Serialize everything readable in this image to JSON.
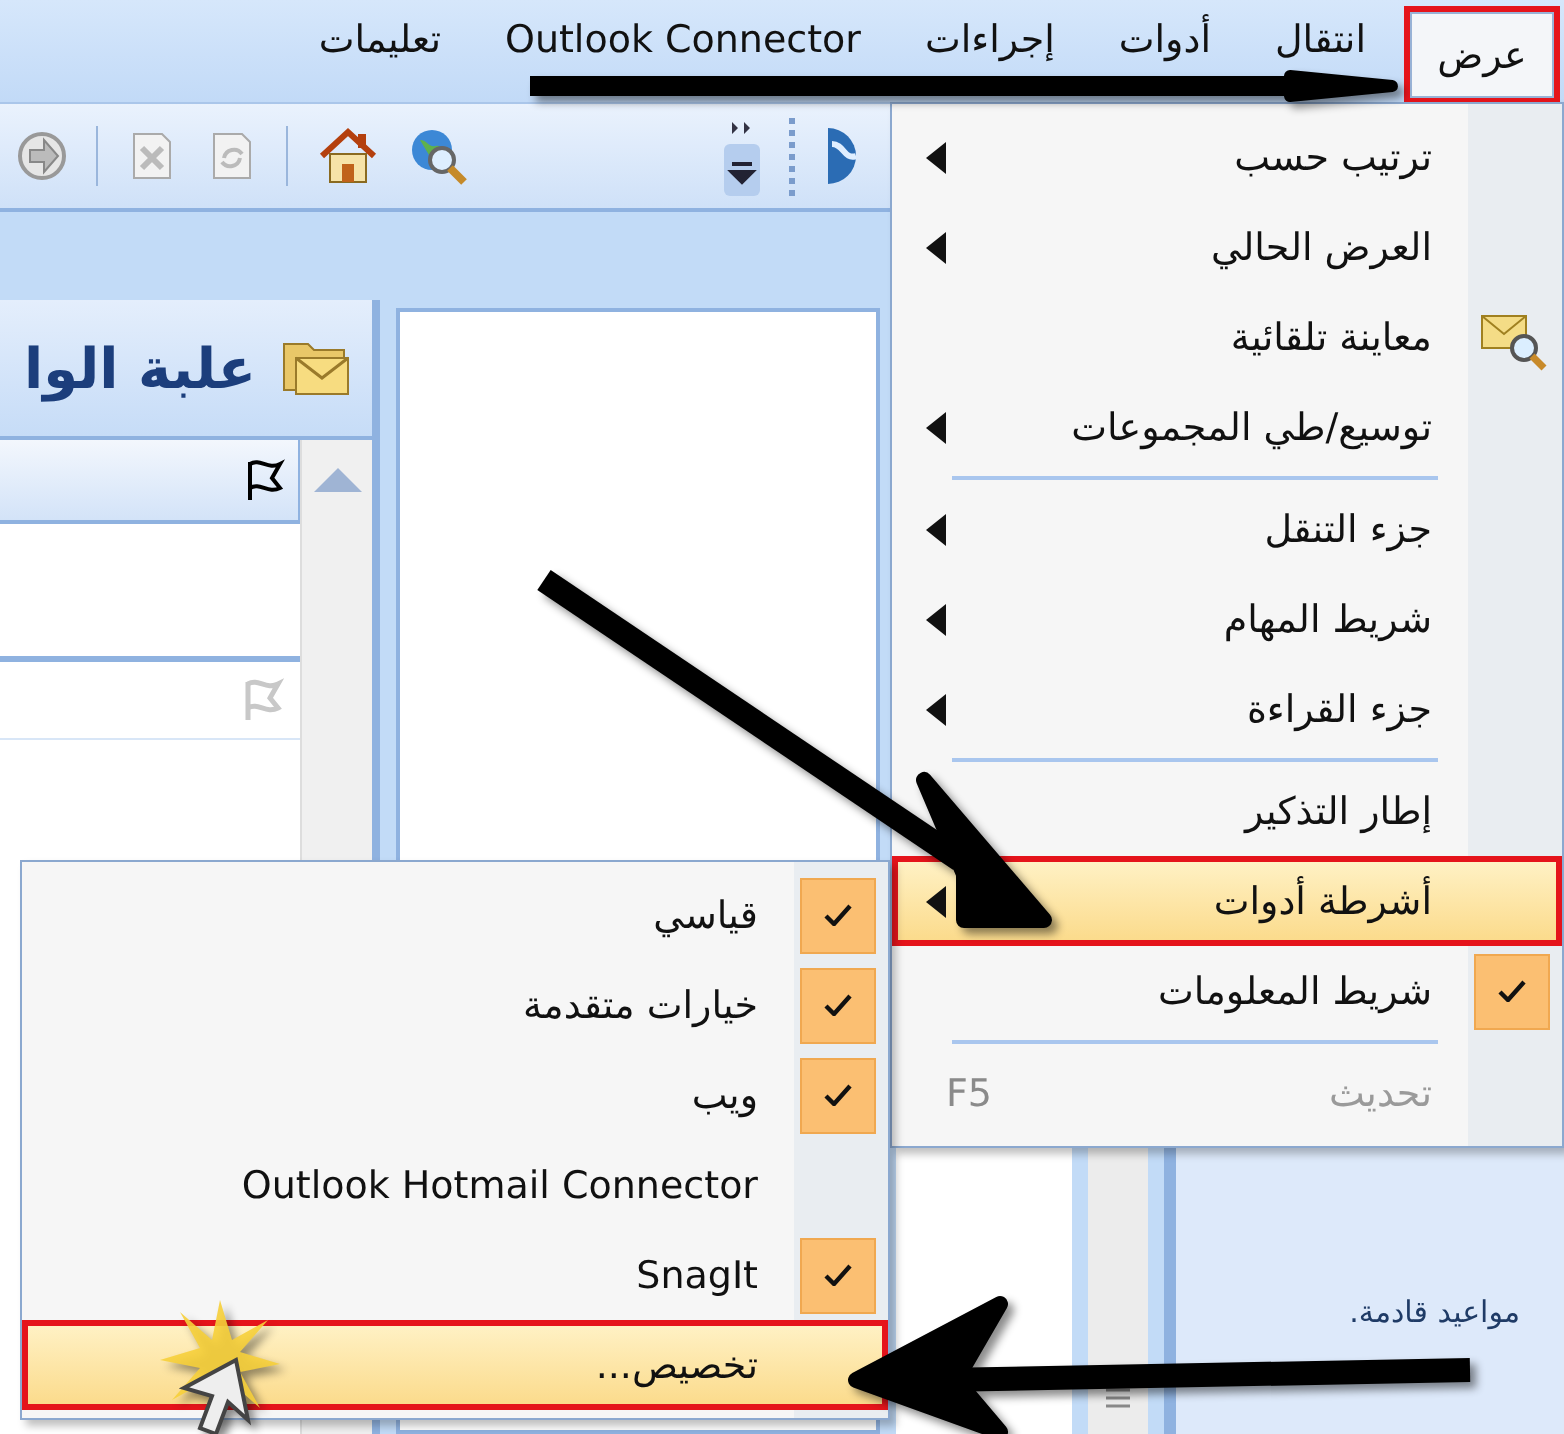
{
  "menu_bar": [
    {
      "label": "عرض",
      "selected": true
    },
    {
      "label": "انتقال",
      "selected": false
    },
    {
      "label": "أدوات",
      "selected": false
    },
    {
      "label": "إجراءات",
      "selected": false
    },
    {
      "label": "Outlook Connector",
      "selected": false
    },
    {
      "label": "تعليمات",
      "selected": false
    }
  ],
  "folder_pane": {
    "title": "علبة الوا"
  },
  "calendar_note": "مواعيد قادمة.",
  "view_menu": [
    {
      "kind": "submenu",
      "label": "ترتيب حسب",
      "selected": false,
      "checked": false,
      "disabled": false,
      "icon": false
    },
    {
      "kind": "submenu",
      "label": "العرض الحالي",
      "selected": false,
      "checked": false,
      "disabled": false,
      "icon": false
    },
    {
      "kind": "command",
      "label": "معاينة تلقائية",
      "selected": false,
      "checked": false,
      "disabled": false,
      "icon": true
    },
    {
      "kind": "submenu",
      "label": "توسيع/طي المجموعات",
      "selected": false,
      "checked": false,
      "disabled": false,
      "icon": false
    },
    {
      "kind": "separator"
    },
    {
      "kind": "submenu",
      "label": "جزء التنقل",
      "selected": false,
      "checked": false,
      "disabled": false,
      "icon": false
    },
    {
      "kind": "submenu",
      "label": "شريط المهام",
      "selected": false,
      "checked": false,
      "disabled": false,
      "icon": false
    },
    {
      "kind": "submenu",
      "label": "جزء القراءة",
      "selected": false,
      "checked": false,
      "disabled": false,
      "icon": false
    },
    {
      "kind": "separator"
    },
    {
      "kind": "command",
      "label": "إطار التذكير",
      "selected": false,
      "checked": false,
      "disabled": false,
      "icon": false
    },
    {
      "kind": "submenu",
      "label": "أشرطة أدوات",
      "selected": true,
      "checked": false,
      "disabled": false,
      "icon": false
    },
    {
      "kind": "command",
      "label": "شريط المعلومات",
      "selected": false,
      "checked": true,
      "disabled": false,
      "icon": false
    },
    {
      "kind": "separator"
    },
    {
      "kind": "command",
      "label": "تحديث",
      "shortcut": "F5",
      "selected": false,
      "checked": false,
      "disabled": true,
      "icon": false
    }
  ],
  "toolbars_menu": [
    {
      "kind": "command",
      "label": "قياسي",
      "selected": false,
      "checked": true
    },
    {
      "kind": "command",
      "label": "خيارات متقدمة",
      "selected": false,
      "checked": true
    },
    {
      "kind": "command",
      "label": "ويب",
      "selected": false,
      "checked": true
    },
    {
      "kind": "command",
      "label": "Outlook Hotmail Connector",
      "selected": false,
      "checked": false
    },
    {
      "kind": "command",
      "label": "SnagIt",
      "selected": false,
      "checked": true
    },
    {
      "kind": "command",
      "label": "تخصيص...",
      "selected": true,
      "checked": false
    }
  ]
}
